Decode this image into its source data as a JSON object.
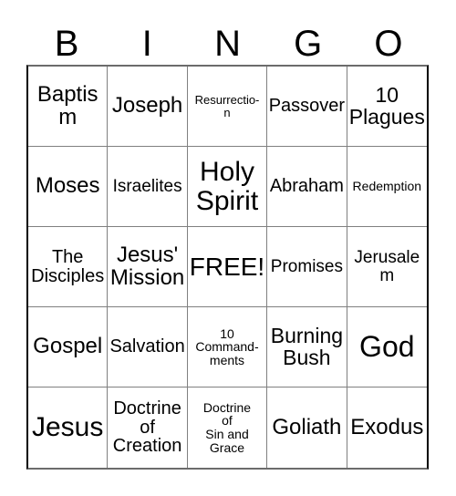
{
  "card": {
    "headers": [
      "B",
      "I",
      "N",
      "G",
      "O"
    ],
    "free_space_label": "FREE!",
    "rows": [
      [
        {
          "text": "Baptism",
          "size": "fs-m"
        },
        {
          "text": "Joseph",
          "size": "fs-m"
        },
        {
          "text": "Resurrectio-\nn",
          "size": "fs-tiny"
        },
        {
          "text": "Passover",
          "size": "fs-s"
        },
        {
          "text": "10\nPlagues",
          "size": "fs-ml"
        }
      ],
      [
        {
          "text": "Moses",
          "size": "fs-m"
        },
        {
          "text": "Israelites",
          "size": "fs-ss"
        },
        {
          "text": "Holy\nSpirit",
          "size": "fs-xl"
        },
        {
          "text": "Abraham",
          "size": "fs-s"
        },
        {
          "text": "Redemption",
          "size": "fs-xxs"
        }
      ],
      [
        {
          "text": "The\nDisciples",
          "size": "fs-s"
        },
        {
          "text": "Jesus'\nMission",
          "size": "fs-m"
        },
        {
          "text": "FREE!",
          "size": "fs-l"
        },
        {
          "text": "Promises",
          "size": "fs-ss"
        },
        {
          "text": "Jerusalem",
          "size": "fs-ss"
        }
      ],
      [
        {
          "text": "Gospel",
          "size": "fs-m"
        },
        {
          "text": "Salvation",
          "size": "fs-s"
        },
        {
          "text": "10\nCommand-\nments",
          "size": "fs-xxs"
        },
        {
          "text": "Burning\nBush",
          "size": "fs-ml"
        },
        {
          "text": "God",
          "size": "fs-xxl"
        }
      ],
      [
        {
          "text": "Jesus",
          "size": "fs-xl"
        },
        {
          "text": "Doctrine\nof\nCreation",
          "size": "fs-s"
        },
        {
          "text": "Doctrine\nof\nSin and\nGrace",
          "size": "fs-xxs"
        },
        {
          "text": "Goliath",
          "size": "fs-m"
        },
        {
          "text": "Exodus",
          "size": "fs-m"
        }
      ]
    ]
  },
  "colors": {
    "background": "#ffffff",
    "text": "#000000",
    "grid_line": "#808080",
    "grid_border": "#000000"
  }
}
